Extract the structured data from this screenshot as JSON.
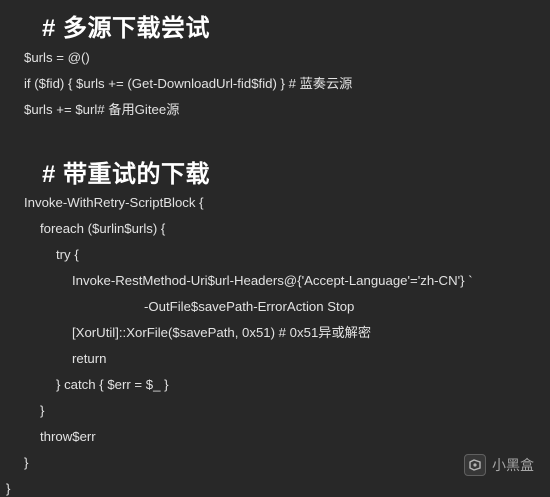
{
  "sections": [
    {
      "heading": "# 多源下载尝试",
      "lines": [
        "$urls = @()",
        "if ($fid) { $urls += (Get-DownloadUrl-fid$fid) } # 蓝奏云源",
        "$urls += $url# 备用Gitee源"
      ]
    },
    {
      "heading": "# 带重试的下载",
      "lines": [
        "Invoke-WithRetry-ScriptBlock {",
        "foreach ($urlin$urls) {",
        "try {",
        "Invoke-RestMethod-Uri$url-Headers@{'Accept-Language'='zh-CN'} `",
        "-OutFile$savePath-ErrorAction Stop",
        "[XorUtil]::XorFile($savePath, 0x51) # 0x51异或解密",
        "return",
        "} catch { $err = $_ }",
        "}",
        "throw$err",
        "}",
        "}"
      ]
    }
  ],
  "watermark": {
    "text": "小黑盒",
    "icon": "xiaoheihe-logo-icon"
  }
}
